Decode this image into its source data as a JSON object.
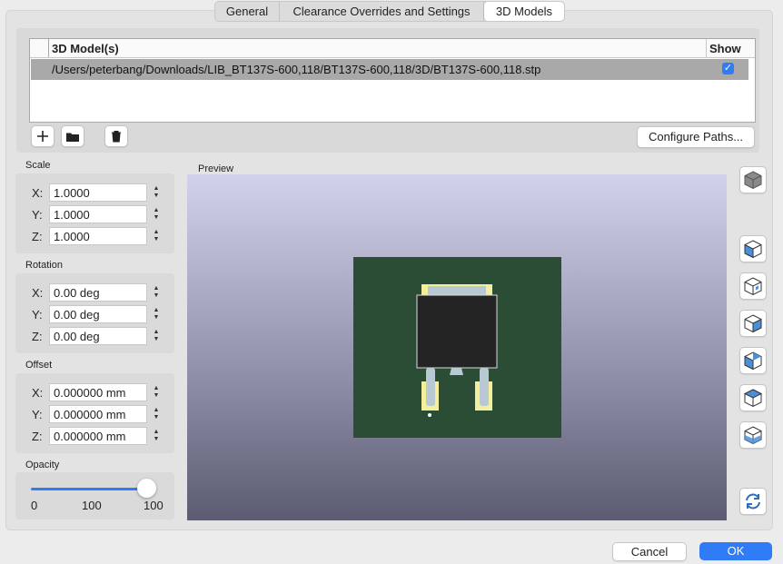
{
  "tabs": [
    "General",
    "Clearance Overrides and Settings",
    "3D Models"
  ],
  "models_table": {
    "col_model": "3D Model(s)",
    "col_show": "Show",
    "rows": [
      {
        "path": "/Users/peterbang/Downloads/LIB_BT137S-600,118/BT137S-600,118/3D/BT137S-600,118.stp",
        "show": true
      }
    ]
  },
  "toolbar": {
    "add_icon": "plus-icon",
    "open_icon": "folder-icon",
    "delete_icon": "trash-icon",
    "configure_label": "Configure Paths..."
  },
  "scale": {
    "label": "Scale",
    "x_label": "X:",
    "x": "1.0000",
    "y_label": "Y:",
    "y": "1.0000",
    "z_label": "Z:",
    "z": "1.0000"
  },
  "rotation": {
    "label": "Rotation",
    "x_label": "X:",
    "x": "0.00 deg",
    "y_label": "Y:",
    "y": "0.00 deg",
    "z_label": "Z:",
    "z": "0.00 deg"
  },
  "offset": {
    "label": "Offset",
    "x_label": "X:",
    "x": "0.000000 mm",
    "y_label": "Y:",
    "y": "0.000000 mm",
    "z_label": "Z:",
    "z": "0.000000 mm"
  },
  "opacity": {
    "label": "Opacity",
    "min": "0",
    "mid": "100",
    "max": "100",
    "value_fraction": 1.0
  },
  "preview": {
    "label": "Preview"
  },
  "view_buttons": [
    "iso-cube-icon",
    "view-front-icon",
    "view-back-icon",
    "view-left-icon",
    "view-right-icon",
    "view-top-icon",
    "view-bottom-icon",
    "refresh-icon"
  ],
  "dialog": {
    "cancel": "Cancel",
    "ok": "OK"
  },
  "colors": {
    "accent": "#2f7cf6",
    "board": "#2c4d35",
    "pad": "#f3ef9a",
    "body": "#242424"
  }
}
